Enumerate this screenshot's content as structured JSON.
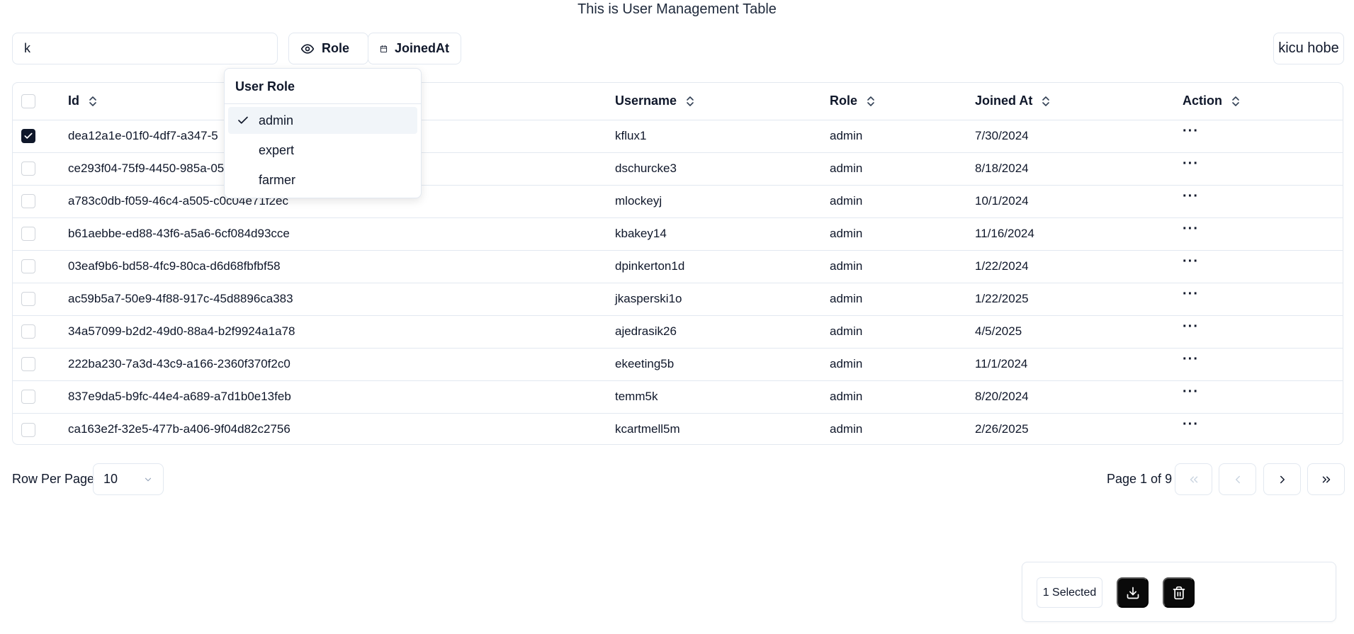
{
  "page": {
    "title": "This is User Management Table"
  },
  "search": {
    "value": "k"
  },
  "toolbar": {
    "role_label": "Role",
    "joined_label": "JoinedAt",
    "user_label": "kicu hobe"
  },
  "role_dropdown": {
    "title": "User Role",
    "options": [
      {
        "label": "admin",
        "checked": true
      },
      {
        "label": "expert",
        "checked": false
      },
      {
        "label": "farmer",
        "checked": false
      }
    ]
  },
  "table": {
    "columns": [
      "Id",
      "Username",
      "Role",
      "Joined At",
      "Action"
    ],
    "action_icon": "more-horizontal-icon",
    "rows": [
      {
        "id": "dea12a1e-01f0-4df7-a347-5",
        "username": "kflux1",
        "role": "admin",
        "joined": "7/30/2024",
        "selected": true
      },
      {
        "id": "ce293f04-75f9-4450-985a-05",
        "username": "dschurcke3",
        "role": "admin",
        "joined": "8/18/2024",
        "selected": false
      },
      {
        "id": "a783c0db-f059-46c4-a505-c0c04e71f2ec",
        "username": "mlockeyj",
        "role": "admin",
        "joined": "10/1/2024",
        "selected": false
      },
      {
        "id": "b61aebbe-ed88-43f6-a5a6-6cf084d93cce",
        "username": "kbakey14",
        "role": "admin",
        "joined": "11/16/2024",
        "selected": false
      },
      {
        "id": "03eaf9b6-bd58-4fc9-80ca-d6d68fbfbf58",
        "username": "dpinkerton1d",
        "role": "admin",
        "joined": "1/22/2024",
        "selected": false
      },
      {
        "id": "ac59b5a7-50e9-4f88-917c-45d8896ca383",
        "username": "jkasperski1o",
        "role": "admin",
        "joined": "1/22/2025",
        "selected": false
      },
      {
        "id": "34a57099-b2d2-49d0-88a4-b2f9924a1a78",
        "username": "ajedrasik26",
        "role": "admin",
        "joined": "4/5/2025",
        "selected": false
      },
      {
        "id": "222ba230-7a3d-43c9-a166-2360f370f2c0",
        "username": "ekeeting5b",
        "role": "admin",
        "joined": "11/1/2024",
        "selected": false
      },
      {
        "id": "837e9da5-b9fc-44e4-a689-a7d1b0e13feb",
        "username": "temm5k",
        "role": "admin",
        "joined": "8/20/2024",
        "selected": false
      },
      {
        "id": "ca163e2f-32e5-477b-a406-9f04d82c2756",
        "username": "kcartmell5m",
        "role": "admin",
        "joined": "2/26/2025",
        "selected": false
      }
    ]
  },
  "pagination": {
    "rows_label": "Row Per Page",
    "rows_value": "10",
    "page_info": "Page 1 of 9"
  },
  "selection_bar": {
    "selected_label": "1 Selected",
    "download_icon": "download-icon",
    "delete_icon": "trash-icon"
  }
}
